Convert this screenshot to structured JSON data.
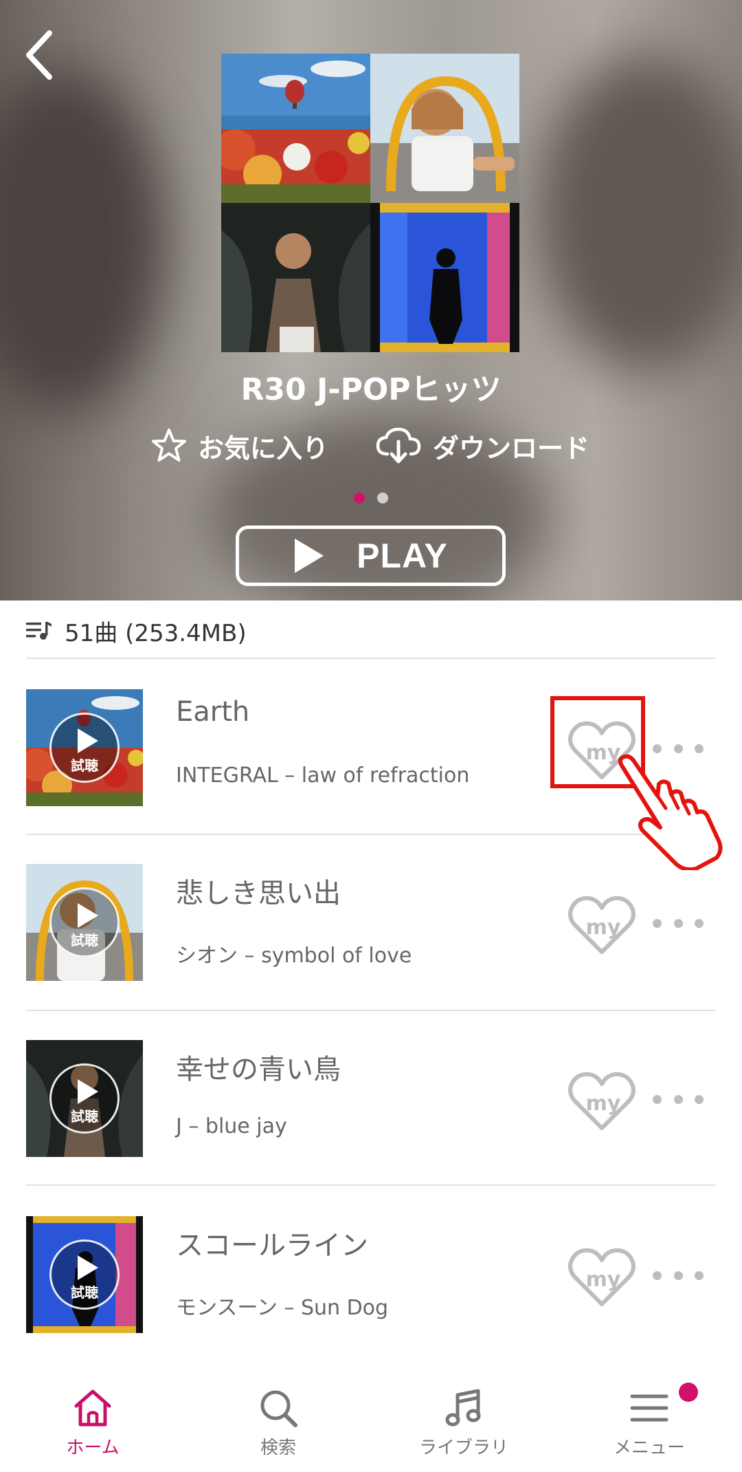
{
  "playlist": {
    "title": "R30 J-POPヒッツ",
    "favorite_label": "お気に入り",
    "download_label": "ダウンロード",
    "play_label": "PLAY",
    "track_count": "51曲 (253.4MB)",
    "carousel_pages": 2,
    "carousel_active": 1
  },
  "preview_label": "試聴",
  "my_label": "my",
  "tracks": [
    {
      "title": "Earth",
      "subtitle": "INTEGRAL – law of refraction"
    },
    {
      "title": "悲しき思い出",
      "subtitle": "シオン – symbol of love"
    },
    {
      "title": "幸せの青い鳥",
      "subtitle": "J –  blue jay"
    },
    {
      "title": "スコールライン",
      "subtitle": "モンスーン – Sun Dog"
    }
  ],
  "nav": {
    "home": "ホーム",
    "search": "検索",
    "library": "ライブラリ",
    "menu": "メニュー"
  },
  "colors": {
    "accent": "#c8106a",
    "highlight": "#e3140f",
    "icon_gray": "#bdbdbd"
  },
  "icons": [
    "back-arrow-icon",
    "star-icon",
    "cloud-download-icon",
    "play-icon",
    "playlist-icon",
    "heart-my-icon",
    "more-icon",
    "home-icon",
    "search-icon",
    "music-note-icon",
    "menu-icon",
    "pointing-hand-icon"
  ]
}
